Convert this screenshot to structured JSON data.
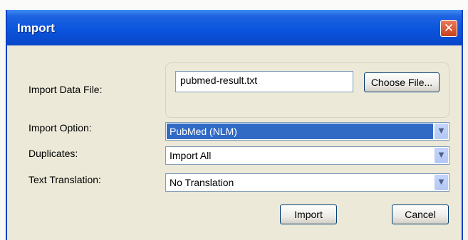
{
  "window": {
    "title": "Import",
    "close_icon": "close-icon"
  },
  "file": {
    "label": "Import Data File:",
    "value": "pubmed-result.txt",
    "choose_label": "Choose File..."
  },
  "import_option": {
    "label": "Import Option:",
    "value": "PubMed (NLM)"
  },
  "duplicates": {
    "label": "Duplicates:",
    "value": "Import All"
  },
  "translation": {
    "label": "Text Translation:",
    "value": "No Translation"
  },
  "buttons": {
    "import_label": "Import",
    "cancel_label": "Cancel"
  },
  "colors": {
    "title_bar": "#0a55dd",
    "selection": "#316ac5",
    "close": "#c8401c",
    "dialog_bg": "#ece9d8"
  }
}
